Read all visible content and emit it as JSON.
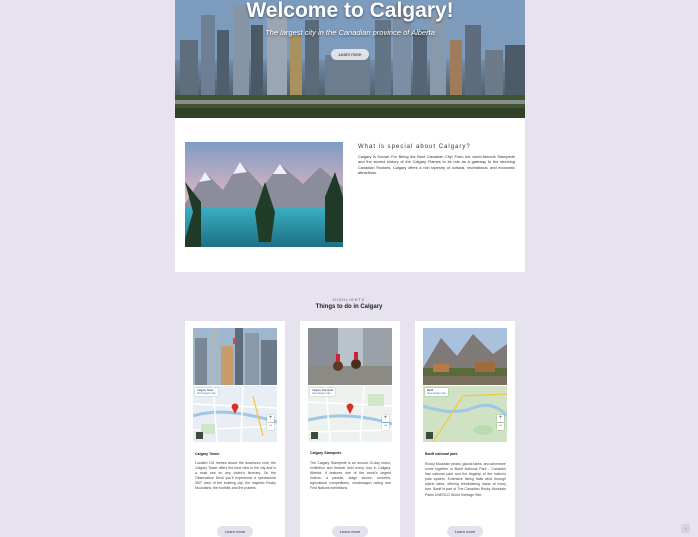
{
  "hero": {
    "title": "Welcome to Calgary!",
    "subtitle": "The largest city in the Canadian province of Alberta",
    "button": "Learn more"
  },
  "about": {
    "title": "What is special about Calgary?",
    "text": "Calgary is Known For Being the Best Canadian City! From the world-famous Stampede and the storied history of the Calgary Flames to its role as a gateway to the stunning Canadian Rockies, Calgary offers a rich tapestry of cultural, recreational, and economic attractions."
  },
  "highlights": {
    "eyebrow": "HIGHLIGHTS",
    "title": "Things to do in Calgary",
    "cards": [
      {
        "name": "Calgary Tower",
        "desc": "Located 191 metres above the downtown core, the Calgary Tower offers the best view in the city and is a must see on any visitor's itinerary. On the Observation Deck you'll experience a spectacular 360° view of the bustling city, the majestic Rocky Mountains, the foothills and the prairies.",
        "button": "Learn more",
        "map": {
          "place": "Calgary Tower",
          "link": "View larger map",
          "zoom_in": "+",
          "zoom_out": "−"
        }
      },
      {
        "name": "Calgary Stampede",
        "desc": "The Calgary Stampede is an annual 10-day rodeo, exhibition and festival held every July in Calgary, Alberta. It features one of the world's largest rodeos, a parade, stage shows, concerts, agricultural competitions, chuckwagon racing and First Nations exhibitions.",
        "button": "Learn more",
        "map": {
          "place": "Calgary Stampede",
          "link": "View larger map",
          "zoom_in": "+",
          "zoom_out": "−"
        }
      },
      {
        "name": "Banff national park",
        "desc": "Rocky Mountain peaks, glacial lakes, and adventure come together in Banff National Park - Canada's first national park and the flagship of the nation's park system. Extensive hiking trails wind through alpine lakes, offering breathtaking vistas at every turn. Banff is part of The Canadian Rocky Mountain Parks UNESCO World Heritage Site.",
        "button": "Learn more",
        "map": {
          "place": "Banff",
          "link": "View larger map",
          "zoom_in": "+",
          "zoom_out": "−"
        }
      }
    ]
  },
  "scroll_top": "↑"
}
